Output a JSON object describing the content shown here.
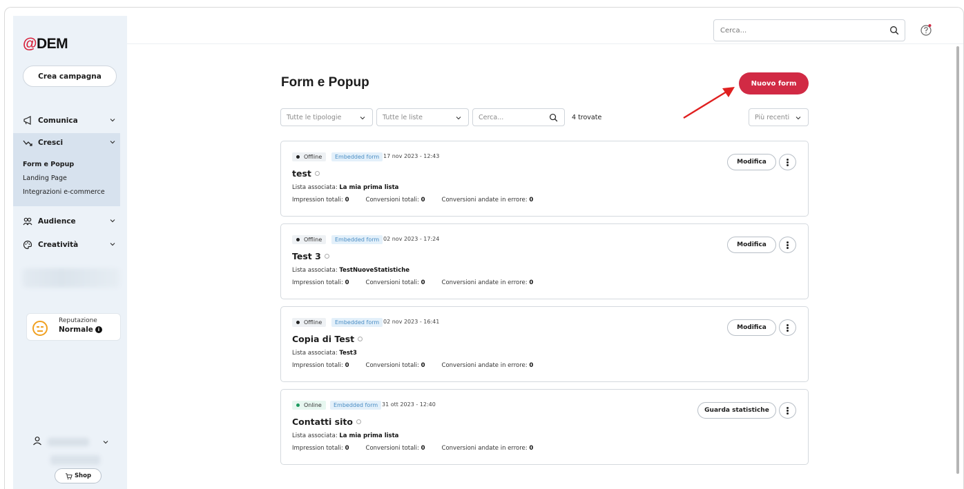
{
  "brand": {
    "logo_at": "@",
    "logo_text": "DEM",
    "accent": "#d12a44"
  },
  "sidebar": {
    "create_campaign": "Crea campagna",
    "nav": [
      {
        "label": "Comunica",
        "icon": "megaphone-icon"
      },
      {
        "label": "Cresci",
        "icon": "trend-icon"
      },
      {
        "label": "Audience",
        "icon": "people-icon"
      },
      {
        "label": "Creatività",
        "icon": "palette-icon"
      }
    ],
    "cresci_sub": [
      "Form e Popup",
      "Landing Page",
      "Integrazioni e-commerce"
    ],
    "reputation_label": "Reputazione",
    "reputation_value": "Normale",
    "shop_label": "Shop"
  },
  "topbar": {
    "search_placeholder": "Cerca..."
  },
  "main": {
    "title": "Form e Popup",
    "new_button": "Nuovo form",
    "filters": {
      "types": "Tutte le tipologie",
      "lists": "Tutte le liste",
      "search": "Cerca...",
      "found": "4 trovate",
      "sort": "Più recenti"
    },
    "labels": {
      "list": "Lista associata:",
      "impressions": "Impression totali:",
      "conversions": "Conversioni totali:",
      "errors": "Conversioni andate in errore:"
    },
    "cards": [
      {
        "status": "Offline",
        "type": "Embedded form",
        "date": "17 nov 2023 - 12:43",
        "name": "test",
        "list": "La mia prima lista",
        "impressions": "0",
        "conversions": "0",
        "errors": "0",
        "action": "Modifica"
      },
      {
        "status": "Offline",
        "type": "Embedded form",
        "date": "02 nov 2023 - 17:24",
        "name": "Test 3",
        "list": "TestNuoveStatistiche",
        "impressions": "0",
        "conversions": "0",
        "errors": "0",
        "action": "Modifica"
      },
      {
        "status": "Offline",
        "type": "Embedded form",
        "date": "02 nov 2023 - 16:41",
        "name": "Copia di Test",
        "list": "Test3",
        "impressions": "0",
        "conversions": "0",
        "errors": "0",
        "action": "Modifica"
      },
      {
        "status": "Online",
        "type": "Embedded form",
        "date": "31 ott 2023 - 12:40",
        "name": "Contatti sito",
        "list": "La mia prima lista",
        "impressions": "0",
        "conversions": "0",
        "errors": "0",
        "action": "Guarda statistiche"
      }
    ]
  }
}
